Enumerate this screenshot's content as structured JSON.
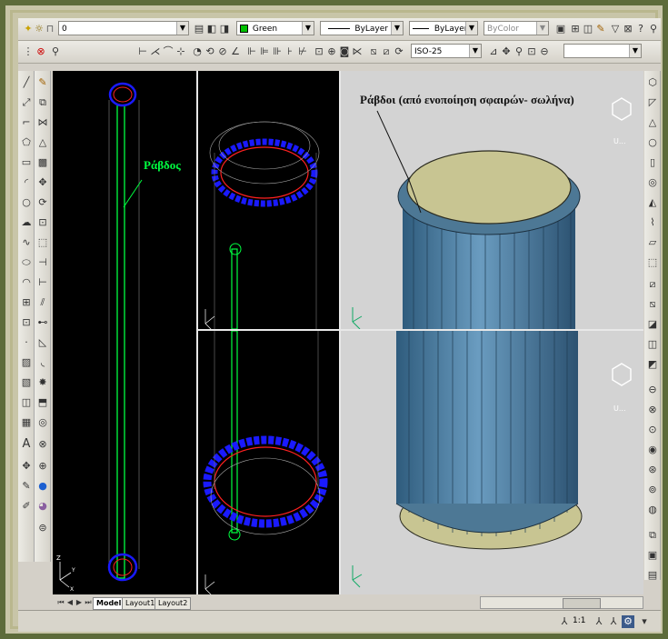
{
  "toolbar_top": {
    "layer_name": "0",
    "color": "Green",
    "color_swatch": "#00c000",
    "linetype": "ByLayer",
    "lineweight": "ByLayer",
    "plotstyle": "ByColor"
  },
  "toolbar_dim": {
    "dimstyle": "ISO-25"
  },
  "viewports": {
    "left_label": "Ράβδος",
    "right_label": "Ράβδοι (από ενοποίηση σφαιρών- σωλήνα)",
    "axis_x": "X",
    "axis_y": "Y",
    "axis_z": "Z"
  },
  "tabs": {
    "model": "Model",
    "layout1": "Layout1",
    "layout2": "Layout2"
  },
  "status": {
    "scale": "1:1"
  },
  "colors": {
    "viewport_bg": "#000000",
    "viewport_3d_bg": "#d3d3d3",
    "rod_green": "#00ff40",
    "ring_blue": "#1a1aff",
    "ring_red": "#ff2020",
    "tube_fill": "#4e7ea1",
    "cap_fill": "#c8c592"
  }
}
